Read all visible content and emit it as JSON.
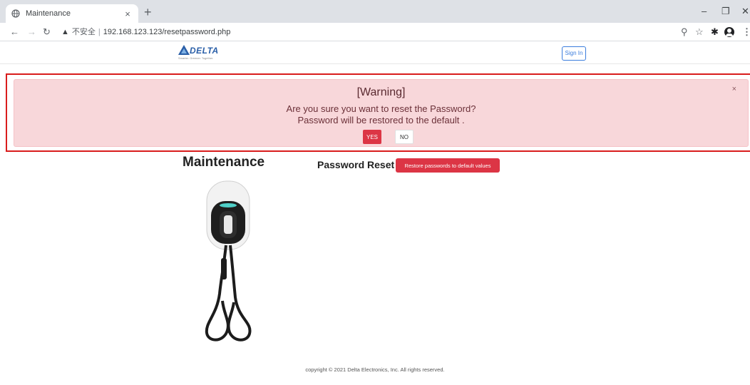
{
  "browser": {
    "tab_title": "Maintenance",
    "tab_close": "×",
    "new_tab": "+",
    "security_label": "不安全",
    "separator": "|",
    "url": "192.168.123.123/resetpassword.php",
    "icons": [
      "globe-icon",
      "back-icon",
      "forward-icon",
      "reload-icon",
      "warning-icon",
      "zoom-icon",
      "star-icon",
      "extensions-icon",
      "profile-icon",
      "menu-icon"
    ]
  },
  "header": {
    "logo_text": "DELTA",
    "logo_tagline": "Smarter. Greener. Together.",
    "signin_label": "Sign In"
  },
  "alert": {
    "title": "[Warning]",
    "line1": "Are you sure you want to reset the Password?",
    "line2": "Password will be restored to the default .",
    "close": "×",
    "yes_label": "YES",
    "no_label": "NO"
  },
  "main": {
    "title": "Maintenance",
    "section_label": "Password Reset",
    "restore_button": "Restore passwords to default values"
  },
  "footer": {
    "copyright": "copyright © 2021 Delta Electronics, Inc.    All rights reserved."
  },
  "colors": {
    "alert_bg": "#f8d7da",
    "danger": "#dc3545",
    "highlight_outline": "#d91c1c",
    "brand_blue": "#2a5fa8"
  }
}
